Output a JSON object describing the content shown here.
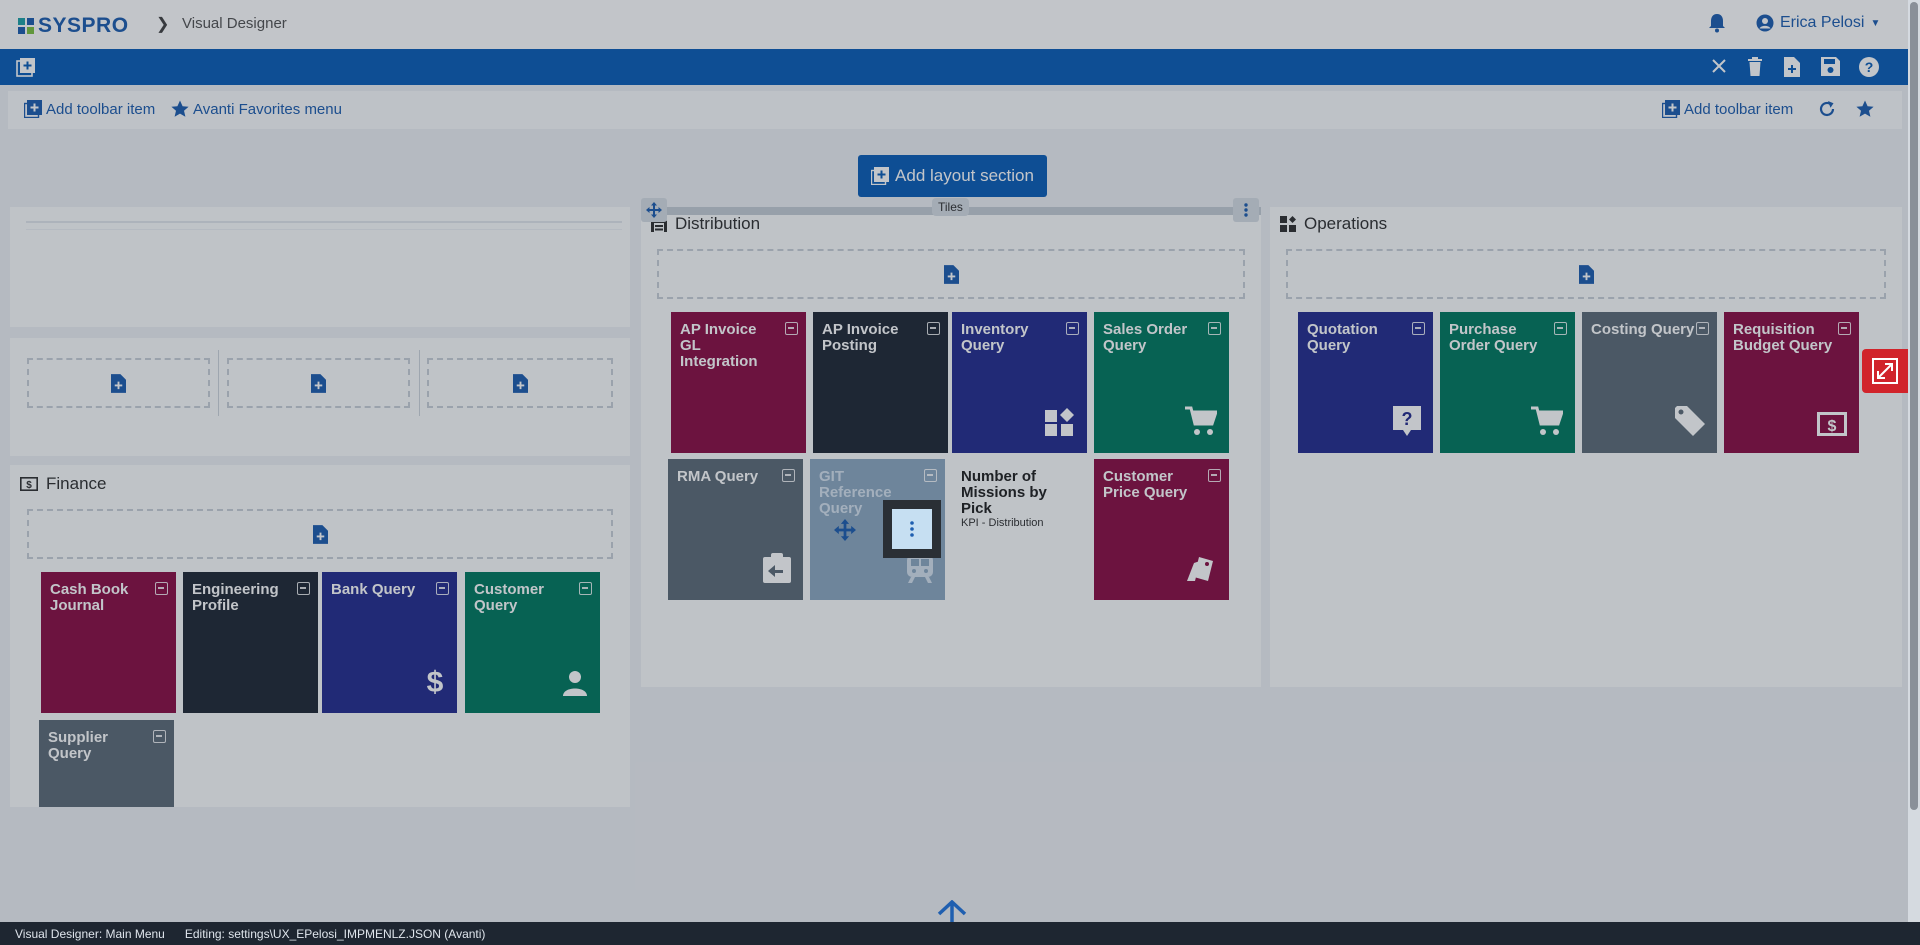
{
  "app": {
    "brand": "SYSPRO",
    "breadcrumb": "Visual Designer",
    "user_name": "Erica Pelosi"
  },
  "toolbar": {
    "add_toolbar_item_left": "Add toolbar item",
    "favorites_menu": "Avanti Favorites menu",
    "add_toolbar_item_right": "Add toolbar item"
  },
  "layout": {
    "add_layout_section": "Add layout section",
    "tiles_label": "Tiles"
  },
  "finance": {
    "title": "Finance",
    "tiles": [
      {
        "label": "Cash Book Journal",
        "color": "#8b0f45",
        "icon": "none"
      },
      {
        "label": "Engineering Profile",
        "color": "#222a37",
        "icon": "none"
      },
      {
        "label": "Bank Query",
        "color": "#272f8f",
        "icon": "dollar-icon"
      },
      {
        "label": "Customer Query",
        "color": "#037a60",
        "icon": "person-icon"
      },
      {
        "label": "Supplier Query",
        "color": "#5f6d79",
        "icon": "none"
      }
    ]
  },
  "distribution": {
    "title": "Distribution",
    "tiles": [
      {
        "label": "AP Invoice GL Integration",
        "color": "#8b0f45"
      },
      {
        "label": "AP Invoice Posting",
        "color": "#222a37"
      },
      {
        "label": "Inventory Query",
        "color": "#272f8f"
      },
      {
        "label": "Sales Order Query",
        "color": "#037a60"
      },
      {
        "label": "RMA Query",
        "color": "#5f6d79"
      },
      {
        "label": "GIT Reference Query",
        "color": "#8ea9c2"
      },
      {
        "label": "Customer Price Query",
        "color": "#8b0f45"
      }
    ],
    "kpi": {
      "title": "Number of Missions by Pick",
      "subtitle": "KPI - Distribution"
    }
  },
  "operations": {
    "title": "Operations",
    "tiles": [
      {
        "label": "Quotation Query",
        "color": "#272f8f"
      },
      {
        "label": "Purchase Order Query",
        "color": "#037a60"
      },
      {
        "label": "Costing Query",
        "color": "#5f6d79"
      },
      {
        "label": "Requisition Budget Query",
        "color": "#8b0f45"
      }
    ]
  },
  "statusbar": {
    "left": "Visual Designer: Main Menu",
    "editing": "Editing: settings\\UX_EPelosi_IMPMENLZ.JSON  (Avanti)"
  }
}
